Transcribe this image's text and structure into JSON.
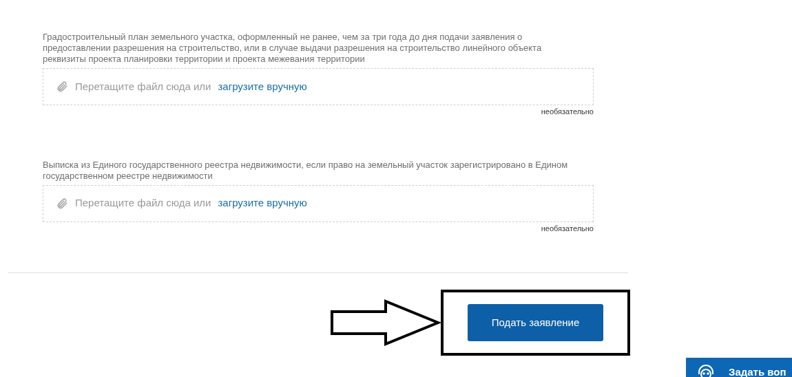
{
  "documents": [
    {
      "label": "Градостроительный план земельного участка, оформленный не ранее, чем за три года до дня подачи заявления о предоставлении разрешения на строительство, или в случае выдачи разрешения на строительство линейного объекта реквизиты проекта планировки территории и проекта межевания территории",
      "drop_text": "Перетащите файл сюда или",
      "upload_link": "загрузите вручную",
      "note": "необязательно"
    },
    {
      "label": "Выписка из Единого государственного реестра недвижимости, если право на земельный участок зарегистрировано в Едином государственном реестре недвижимости",
      "drop_text": "Перетащите файл сюда или",
      "upload_link": "загрузите вручную",
      "note": "необязательно"
    }
  ],
  "submit_button": "Подать заявление",
  "chat_button": "Задать воп"
}
